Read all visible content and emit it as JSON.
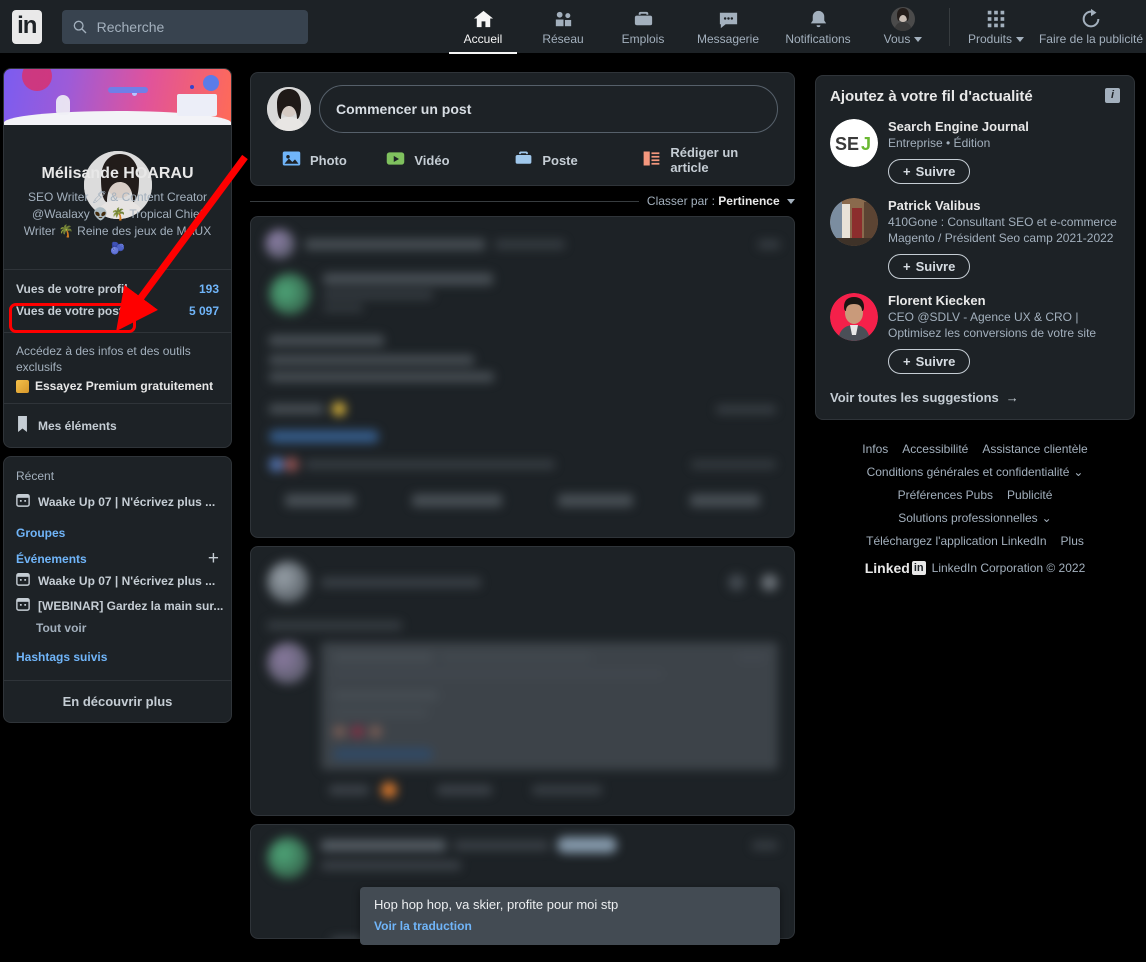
{
  "nav": {
    "logo": "in",
    "search_placeholder": "Recherche",
    "items": [
      {
        "label": "Accueil",
        "icon": "home-icon",
        "active": true
      },
      {
        "label": "Réseau",
        "icon": "network-icon",
        "active": false
      },
      {
        "label": "Emplois",
        "icon": "briefcase-icon",
        "active": false
      },
      {
        "label": "Messagerie",
        "icon": "message-icon",
        "active": false
      },
      {
        "label": "Notifications",
        "icon": "bell-icon",
        "active": false
      },
      {
        "label": "Vous",
        "icon": "avatar-icon",
        "active": false,
        "caret": true
      }
    ],
    "right_items": [
      {
        "label": "Produits",
        "icon": "grid-icon",
        "caret": true
      },
      {
        "label": "Faire de la publicité",
        "icon": "ad-icon",
        "caret": false
      }
    ]
  },
  "profile": {
    "name": "Mélisande HOARAU",
    "headline": "SEO Writer 🖊 & Content Creator @Waalaxy 👽 🌴 Tropical Chief Writer 🌴 Reine des jeux de MAUX 🫐",
    "stats": [
      {
        "label": "Vues de votre profil",
        "value": "193",
        "highlighted": true
      },
      {
        "label": "Vues de votre post",
        "value": "5 097",
        "highlighted": false
      }
    ],
    "premium_sub": "Accédez à des infos et des outils exclusifs",
    "premium_cta": "Essayez Premium gratuitement",
    "my_items": "Mes éléments"
  },
  "sidebar": {
    "recent_title": "Récent",
    "recent_items": [
      {
        "label": "Waake Up 07 | N'écrivez plus ...",
        "icon": "calendar-icon"
      }
    ],
    "groupes": "Groupes",
    "evenements": "Événements",
    "event_items": [
      {
        "label": "Waake Up 07 | N'écrivez plus ...",
        "icon": "calendar-icon"
      },
      {
        "label": "[WEBINAR] Gardez la main sur...",
        "icon": "calendar-icon"
      }
    ],
    "tout_voir": "Tout voir",
    "hashtags": "Hashtags suivis",
    "discover": "En découvrir plus"
  },
  "composer": {
    "placeholder": "Commencer un post",
    "actions": [
      {
        "label": "Photo",
        "icon": "photo-icon",
        "color": "#70b5f9"
      },
      {
        "label": "Vidéo",
        "icon": "video-icon",
        "color": "#7fc15e"
      },
      {
        "label": "Poste",
        "icon": "job-icon",
        "color": "#a0c8ec"
      },
      {
        "label": "Rédiger un article",
        "icon": "article-icon",
        "color": "#f5987e"
      }
    ]
  },
  "feed": {
    "sort_prefix": "Classer par :",
    "sort_value": "Pertinence",
    "tooltip_text": "Hop hop hop, va skier, profite pour moi stp",
    "tooltip_link": "Voir la traduction"
  },
  "suggestions": {
    "title": "Ajoutez à votre fil d'actualité",
    "info_icon": "info-icon",
    "follow_label": "Suivre",
    "see_all": "Voir toutes les suggestions",
    "items": [
      {
        "name": "Search Engine Journal",
        "desc": "Entreprise • Édition",
        "avatar": "sej-logo"
      },
      {
        "name": "Patrick Valibus",
        "desc": "410Gone : Consultant SEO et e-commerce Magento / Président Seo camp 2021-2022",
        "avatar": "photo-bookshelf"
      },
      {
        "name": "Florent Kiecken",
        "desc": "CEO @SDLV - Agence UX & CRO | Optimisez les conversions de votre site",
        "avatar": "photo-red-bg"
      }
    ]
  },
  "footer": {
    "row1": [
      "Infos",
      "Accessibilité",
      "Assistance clientèle"
    ],
    "row2": "Conditions générales et confidentialité",
    "row3": [
      "Préférences Pubs",
      "Publicité"
    ],
    "row4": "Solutions professionnelles",
    "row5": [
      "Téléchargez l'application LinkedIn",
      "Plus"
    ],
    "brand": "Linked",
    "brand_box": "in",
    "copyright": "LinkedIn Corporation © 2022"
  },
  "colors": {
    "page_bg": "#000000",
    "card_bg": "#1d2226",
    "accent_blue": "#70b5f9",
    "text_primary": "#e8e8e8",
    "text_secondary": "#a3b0bd",
    "annotation_red": "#ff0000"
  }
}
